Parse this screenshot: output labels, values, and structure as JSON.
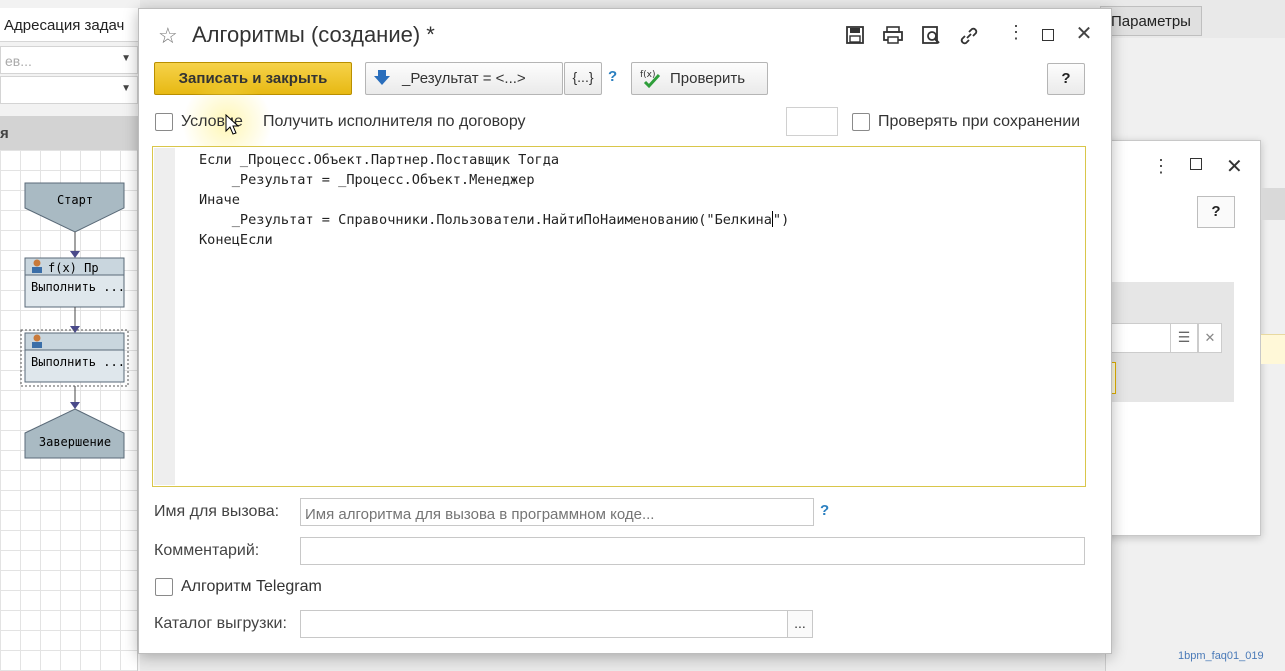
{
  "background": {
    "left_title": "Адресация задач",
    "left_combo1": "ев...",
    "left_combo2": "",
    "left_section": "я",
    "flow": {
      "start": "Старт",
      "node1_header": "f(x)  Пр",
      "node1_label": "Выполнить ...",
      "node2_label": "Выполнить ...",
      "end": "Завершение"
    },
    "params_tab": "Параметры",
    "help_label": "?",
    "watermark": "1bpm_faq01_019"
  },
  "dialog": {
    "title": "Алгоритмы (создание) *",
    "toolbar": {
      "save_close": "Записать и закрыть",
      "result": "_Результат = <...>",
      "braces": "{...}",
      "hint": "?",
      "check": "Проверить",
      "help": "?"
    },
    "condition_label": "Условие",
    "contract_label": "Получить исполнителя по договору",
    "verify_on_save_label": "Проверять при сохранении",
    "code_lines": [
      "Если _Процесс.Объект.Партнер.Поставщик Тогда",
      "    _Результат = _Процесс.Объект.Менеджер",
      "Иначе",
      "    _Результат = Справочники.Пользователи.НайтиПоНаименованию(\"Белкина",
      "КонецЕсли"
    ],
    "code_line4_tail": "\")",
    "fields": {
      "call_name_label": "Имя для вызова:",
      "call_name_placeholder": "Имя алгоритма для вызова в программном коде...",
      "call_name_hint": "?",
      "comment_label": "Комментарий:",
      "telegram_label": "Алгоритм Telegram",
      "export_label": "Каталог выгрузки:",
      "export_button": "..."
    }
  },
  "colors": {
    "accent_yellow": "#e7b913",
    "link_blue": "#2a7fc0",
    "flow_node": "#a9bac3"
  }
}
